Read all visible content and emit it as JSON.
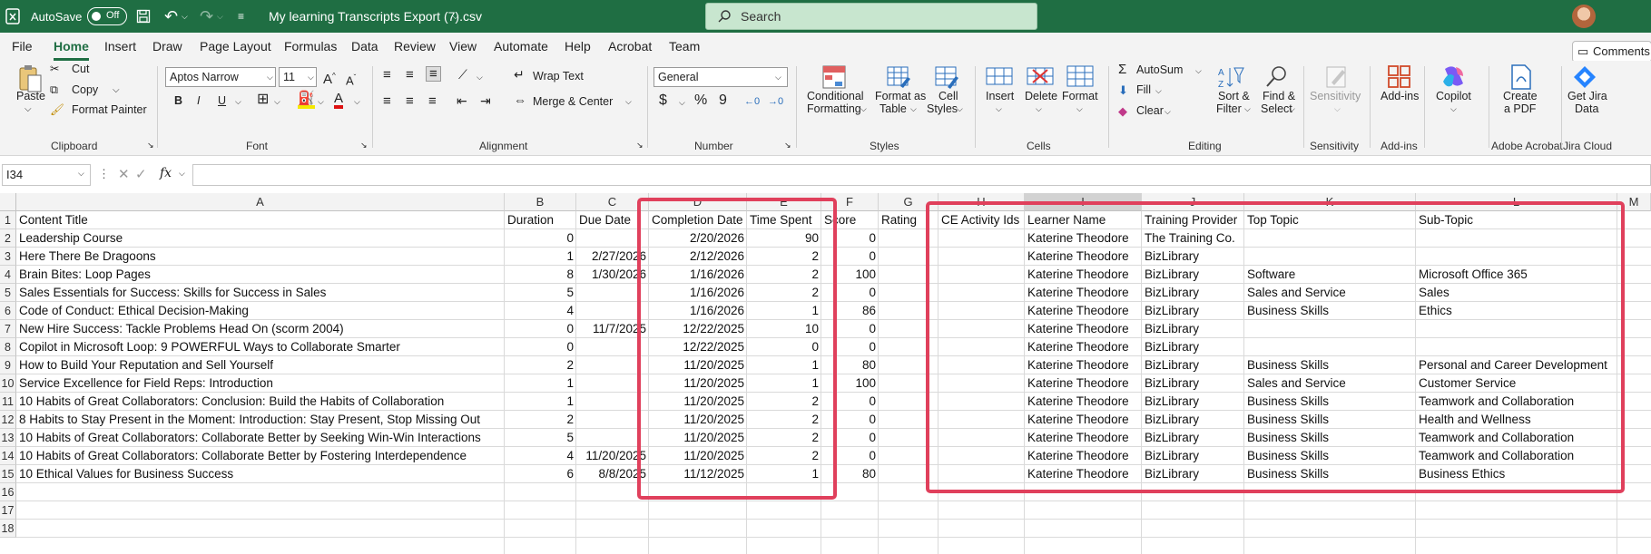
{
  "titlebar": {
    "autosave": "AutoSave",
    "autosave_state": "Off",
    "filename": "My learning Transcripts Export (7).csv",
    "search_placeholder": "Search"
  },
  "menu": {
    "tabs": [
      "File",
      "Home",
      "Insert",
      "Draw",
      "Page Layout",
      "Formulas",
      "Data",
      "Review",
      "View",
      "Automate",
      "Help",
      "Acrobat",
      "Team"
    ],
    "active": "Home",
    "comments": "Comments"
  },
  "ribbon": {
    "clipboard": {
      "paste": "Paste",
      "cut": "Cut",
      "copy": "Copy",
      "format_painter": "Format Painter",
      "label": "Clipboard"
    },
    "font": {
      "name": "Aptos Narrow",
      "size": "11",
      "bold": "B",
      "italic": "I",
      "underline": "U",
      "label": "Font"
    },
    "alignment": {
      "wrap": "Wrap Text",
      "merge": "Merge & Center",
      "label": "Alignment"
    },
    "number": {
      "format": "General",
      "currency": "$",
      "percent": "%",
      "comma": "9",
      "label": "Number"
    },
    "styles": {
      "conditional": "Conditional",
      "conditional2": "Formatting",
      "format_table": "Format as",
      "format_table2": "Table",
      "cell_styles": "Cell",
      "cell_styles2": "Styles",
      "label": "Styles"
    },
    "cells": {
      "insert": "Insert",
      "delete": "Delete",
      "format": "Format",
      "label": "Cells"
    },
    "editing": {
      "autosum": "AutoSum",
      "fill": "Fill",
      "clear": "Clear",
      "sort": "Sort &",
      "sort2": "Filter",
      "find": "Find &",
      "find2": "Select",
      "label": "Editing"
    },
    "sensitivity": {
      "btn": "Sensitivity",
      "label": "Sensitivity"
    },
    "addins": {
      "btn": "Add-ins",
      "label": "Add-ins"
    },
    "copilot": {
      "btn": "Copilot"
    },
    "acrobat": {
      "btn": "Create",
      "btn2": "a PDF",
      "label": "Adobe Acrobat"
    },
    "jira": {
      "btn": "Get Jira",
      "btn2": "Data",
      "label": "Jira Cloud"
    }
  },
  "formula": {
    "namebox": "I34",
    "fx": "fx",
    "value": ""
  },
  "columns": [
    "A",
    "B",
    "C",
    "D",
    "E",
    "F",
    "G",
    "H",
    "I",
    "J",
    "K",
    "L",
    "M"
  ],
  "headers": [
    "Content Title",
    "Duration",
    "Due Date",
    "Completion Date",
    "Time Spent",
    "Score",
    "Rating",
    "CE Activity Ids",
    "Learner Name",
    "Training Provider",
    "Top Topic",
    "Sub-Topic"
  ],
  "rows": [
    [
      "Leadership Course",
      "0",
      "",
      "2/20/2026",
      "90",
      "0",
      "",
      "",
      "Katerine Theodore",
      "The Training Co.",
      "",
      ""
    ],
    [
      "Here There Be Dragoons",
      "1",
      "2/27/2026",
      "2/12/2026",
      "2",
      "0",
      "",
      "",
      "Katerine Theodore",
      "BizLibrary",
      "",
      ""
    ],
    [
      "Brain Bites: Loop Pages",
      "8",
      "1/30/2026",
      "1/16/2026",
      "2",
      "100",
      "",
      "",
      "Katerine Theodore",
      "BizLibrary",
      "Software",
      "Microsoft Office 365"
    ],
    [
      "Sales Essentials for Success: Skills for Success in Sales",
      "5",
      "",
      "1/16/2026",
      "2",
      "0",
      "",
      "",
      "Katerine Theodore",
      "BizLibrary",
      "Sales and Service",
      "Sales"
    ],
    [
      "Code of Conduct: Ethical Decision-Making",
      "4",
      "",
      "1/16/2026",
      "1",
      "86",
      "",
      "",
      "Katerine Theodore",
      "BizLibrary",
      "Business Skills",
      "Ethics"
    ],
    [
      "New Hire Success: Tackle Problems Head On (scorm 2004)",
      "0",
      "11/7/2025",
      "12/22/2025",
      "10",
      "0",
      "",
      "",
      "Katerine Theodore",
      "BizLibrary",
      "",
      ""
    ],
    [
      "Copilot in Microsoft Loop: 9 POWERFUL Ways to Collaborate Smarter",
      "0",
      "",
      "12/22/2025",
      "0",
      "0",
      "",
      "",
      "Katerine Theodore",
      "BizLibrary",
      "",
      ""
    ],
    [
      "How to Build Your Reputation and Sell Yourself",
      "2",
      "",
      "11/20/2025",
      "1",
      "80",
      "",
      "",
      "Katerine Theodore",
      "BizLibrary",
      "Business Skills",
      "Personal and Career Development"
    ],
    [
      "Service Excellence for Field Reps: Introduction",
      "1",
      "",
      "11/20/2025",
      "1",
      "100",
      "",
      "",
      "Katerine Theodore",
      "BizLibrary",
      "Sales and Service",
      "Customer Service"
    ],
    [
      "10 Habits of Great Collaborators: Conclusion: Build the Habits of Collaboration",
      "1",
      "",
      "11/20/2025",
      "2",
      "0",
      "",
      "",
      "Katerine Theodore",
      "BizLibrary",
      "Business Skills",
      "Teamwork and Collaboration"
    ],
    [
      "8 Habits to Stay Present in the Moment: Introduction: Stay Present, Stop Missing Out",
      "2",
      "",
      "11/20/2025",
      "2",
      "0",
      "",
      "",
      "Katerine Theodore",
      "BizLibrary",
      "Business Skills",
      "Health and Wellness"
    ],
    [
      "10 Habits of Great Collaborators: Collaborate Better by Seeking Win-Win Interactions",
      "5",
      "",
      "11/20/2025",
      "2",
      "0",
      "",
      "",
      "Katerine Theodore",
      "BizLibrary",
      "Business Skills",
      "Teamwork and Collaboration"
    ],
    [
      "10 Habits of Great Collaborators: Collaborate Better by Fostering Interdependence",
      "4",
      "11/20/2025",
      "11/20/2025",
      "2",
      "0",
      "",
      "",
      "Katerine Theodore",
      "BizLibrary",
      "Business Skills",
      "Teamwork and Collaboration"
    ],
    [
      "10 Ethical Values for Business Success",
      "6",
      "8/8/2025",
      "11/12/2025",
      "1",
      "80",
      "",
      "",
      "Katerine Theodore",
      "BizLibrary",
      "Business Skills",
      "Business Ethics"
    ]
  ],
  "row_numbers": [
    "1",
    "2",
    "3",
    "4",
    "5",
    "6",
    "7",
    "8",
    "9",
    "10",
    "11",
    "12",
    "13",
    "14",
    "15",
    "16",
    "17",
    "18"
  ],
  "colors": {
    "excel_green": "#1f6e43",
    "highlight": "#e0405c"
  }
}
